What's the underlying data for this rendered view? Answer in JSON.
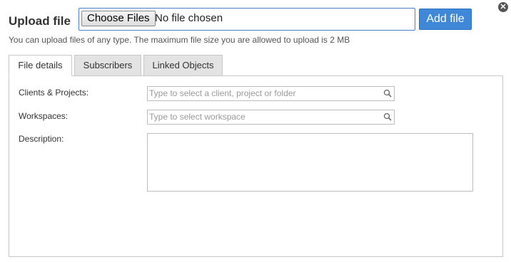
{
  "dialog": {
    "title": "Upload file",
    "close_icon": "close-icon"
  },
  "upload": {
    "choose_label": "Choose Files",
    "status_text": "No file chosen",
    "add_label": "Add file",
    "hint": "You can upload files of any type. The maximum file size you are allowed to upload is 2 MB"
  },
  "tabs": [
    {
      "label": "File details",
      "active": true
    },
    {
      "label": "Subscribers",
      "active": false
    },
    {
      "label": "Linked Objects",
      "active": false
    }
  ],
  "form": {
    "clients": {
      "label": "Clients & Projects:",
      "placeholder": "Type to select a client, project or folder",
      "value": ""
    },
    "workspaces": {
      "label": "Workspaces:",
      "placeholder": "Type to select workspace",
      "value": ""
    },
    "description": {
      "label": "Description:",
      "value": ""
    }
  },
  "colors": {
    "accent": "#3f87d7",
    "tab_inactive": "#e3e3e3",
    "border": "#c8c8c8"
  }
}
